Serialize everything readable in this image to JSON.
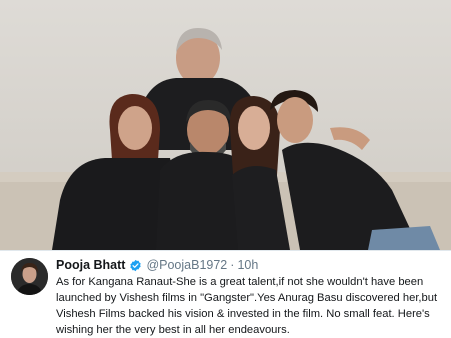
{
  "tweet": {
    "author_name": "Pooja Bhatt",
    "author_handle": "@PoojaB1972",
    "separator": "·",
    "timestamp": "10h",
    "verified": true,
    "avatar_icon": "profile-photo",
    "verified_icon": "verified-badge-icon",
    "lines": [
      "As for Kangana Ranaut-She is a great talent,if not she wouldn't have been",
      "launched by Vishesh films in \"Gangster\".Yes Anurag Basu discovered her,but",
      "Vishesh Films backed his vision & invested in the film. No small feat. Here's",
      "wishing her the very best in all her endeavours."
    ]
  },
  "photo": {
    "description_icon": "group-photo",
    "colors": {
      "backdrop": "#d8d5cf",
      "sofa": "#c9c0b3",
      "clothing": "#1c1c1e",
      "skin": "#c99a80",
      "hair": "#2b1d16"
    }
  },
  "colors": {
    "verified_blue": "#1da1f2",
    "text_primary": "#14171a",
    "text_secondary": "#657786"
  }
}
